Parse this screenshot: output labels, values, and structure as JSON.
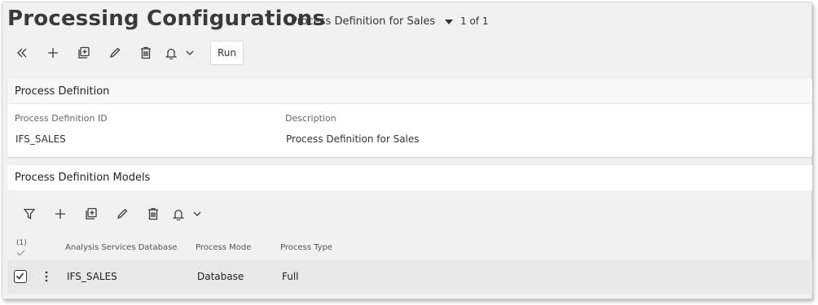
{
  "page": {
    "title": "Processing Configurations",
    "selector_value": "Process Definition for Sales",
    "pager": "1 of 1"
  },
  "toolbar": {
    "run_label": "Run",
    "icons": [
      "collapse-icon",
      "add-icon",
      "duplicate-icon",
      "edit-icon",
      "delete-icon",
      "bell-icon",
      "chevron-down-icon"
    ]
  },
  "process_definition": {
    "header": "Process Definition",
    "id_label": "Process Definition ID",
    "id_value": "IFS_SALES",
    "description_label": "Description",
    "description_value": "Process Definition for Sales"
  },
  "models": {
    "header": "Process Definition Models",
    "selection_count": "(1)",
    "columns": {
      "database": "Analysis Services Database",
      "mode": "Process Mode",
      "type": "Process Type"
    },
    "rows": [
      {
        "database": "IFS_SALES",
        "mode": "Database",
        "type": "Full"
      }
    ]
  }
}
